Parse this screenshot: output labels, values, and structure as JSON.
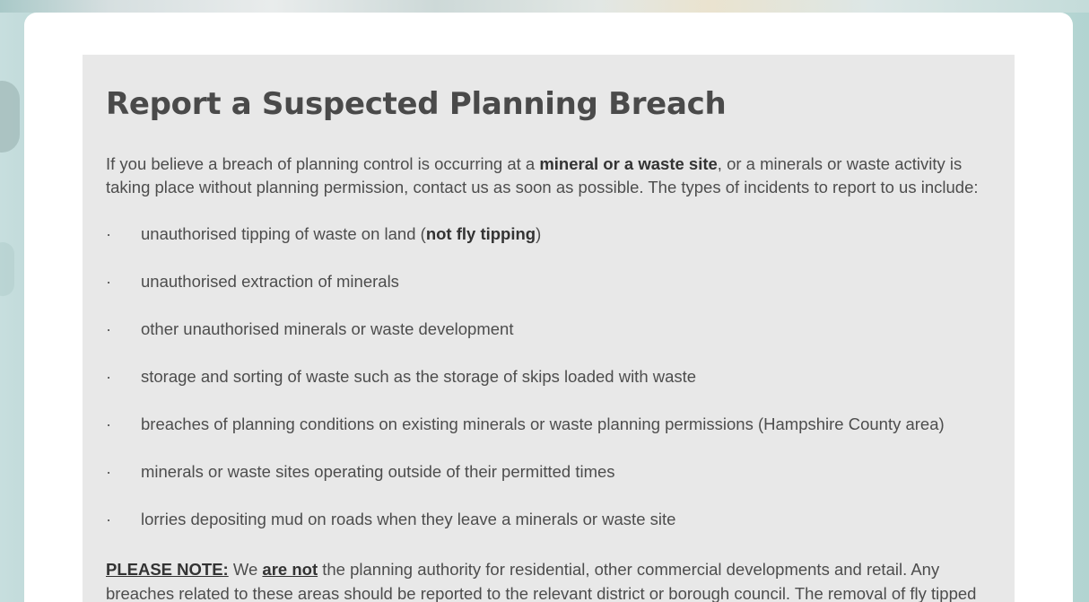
{
  "page": {
    "title": "Report a Suspected Planning Breach",
    "intro": {
      "part1": "If you believe a breach of planning control is occurring at a ",
      "bold": "mineral or a waste site",
      "part2": ", or a minerals or waste activity is taking place without planning permission, contact us as soon as possible. The types of incidents to report to us include:"
    },
    "bullet_glyph": "·",
    "incidents": {
      "item1_text": "unauthorised tipping of waste on land (",
      "item1_bold": "not fly tipping",
      "item1_end": ")",
      "item2": "unauthorised extraction of minerals",
      "item3": "other unauthorised minerals or waste development",
      "item4": "storage and sorting of waste such as the storage of skips loaded with waste",
      "item5": "breaches of planning conditions on existing minerals or waste planning permissions (Hampshire County area)",
      "item6": "minerals or waste sites operating outside of their permitted times",
      "item7": "lorries depositing mud on roads when they leave a minerals or waste site"
    },
    "note": {
      "label": "PLEASE NOTE:",
      "part1": " We ",
      "emphasis": "are not",
      "part2": " the planning authority for residential, other commercial developments and retail. Any breaches related to these areas should be reported to the relevant district or borough council.  The removal of fly tipped"
    }
  },
  "colors": {
    "panel_background": "#e8e8e8",
    "card_background": "#ffffff",
    "title_text": "#4a4a4a",
    "body_text": "#4d4d4d"
  }
}
